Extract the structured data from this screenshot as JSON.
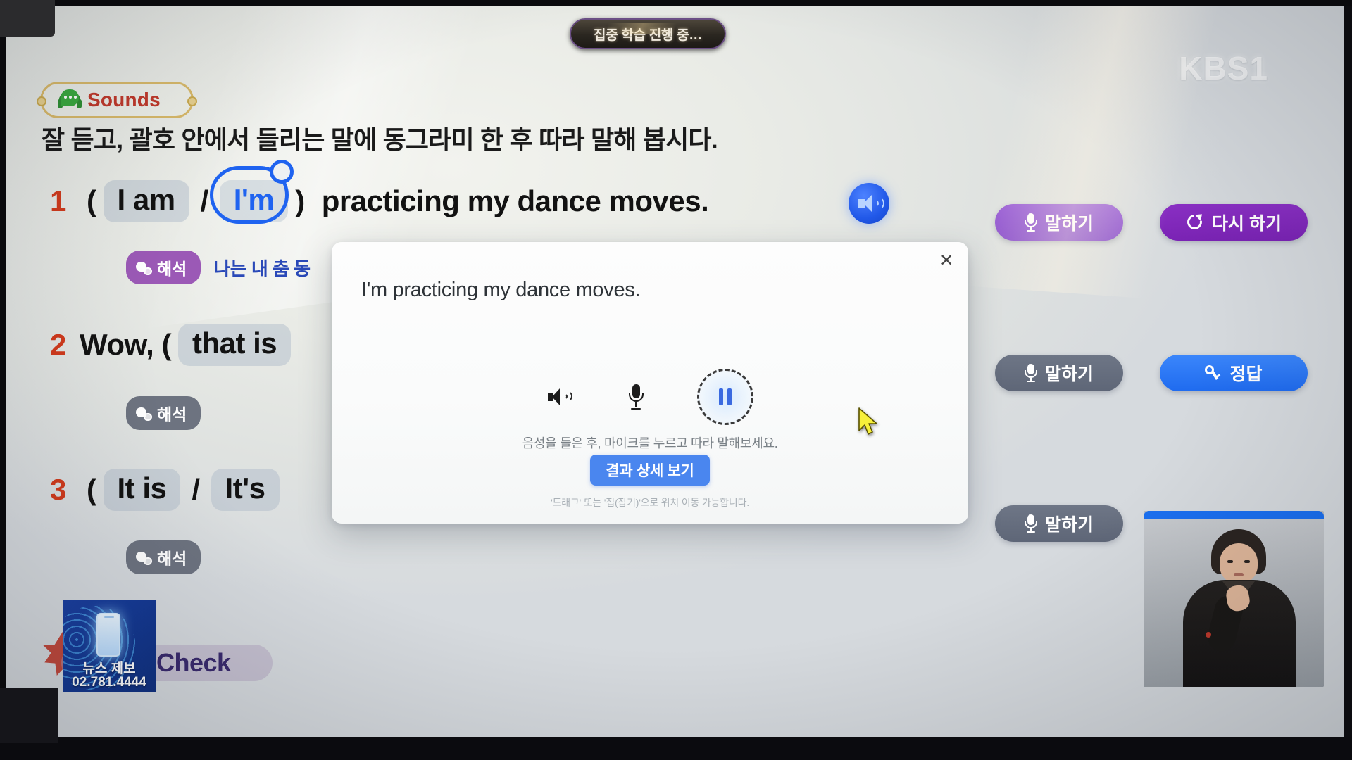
{
  "broadcast": {
    "status_pill": "집중 학습 진행 중…",
    "channel_logo": "KBS",
    "channel_number": "1",
    "news_tip": {
      "label": "뉴스 제보",
      "phone": "02.781.4444"
    }
  },
  "lesson": {
    "section_badge": "Sounds",
    "section_icon": "sounds-headphone-chat-icon",
    "instruction": "잘 듣고, 괄호 안에서 들리는 말에 동그라미 한 후 따라 말해 봅시다.",
    "self_check_label": "Self-Check",
    "items": [
      {
        "number": "1",
        "open_paren": "(",
        "choice_a": "I am",
        "slash": "/",
        "choice_b": "I'm",
        "close_paren": ")",
        "tail": "practicing my dance moves.",
        "circled": "choice_b",
        "hint_badge": "해석",
        "hint_badge_color": "#9b59b6",
        "hint_text": "나는 내 춤 동",
        "speaker_icon": "speaker-icon"
      },
      {
        "number": "2",
        "lead": "Wow, (",
        "choice_a": "that is",
        "hint_badge": "해석",
        "hint_badge_color": "#6d7380"
      },
      {
        "number": "3",
        "open_paren": "(",
        "choice_a": "It is",
        "slash": "/",
        "choice_b": "It's",
        "hint_badge": "해석",
        "hint_badge_color": "#6d7380"
      }
    ]
  },
  "actions": {
    "rows": [
      {
        "speak": "말하기",
        "secondary": "다시 하기",
        "secondary_icon": "refresh-icon",
        "speak_style": "purple",
        "secondary_style": "deep"
      },
      {
        "speak": "말하기",
        "secondary": "정답",
        "secondary_icon": "key-icon",
        "speak_style": "gray",
        "secondary_style": "blue"
      },
      {
        "speak": "말하기",
        "speak_style": "gray"
      }
    ],
    "mic_icon": "mic-icon"
  },
  "modal": {
    "close_icon": "close-icon",
    "sentence": "I'm practicing my dance moves.",
    "controls": {
      "speaker_icon": "speaker-icon",
      "mic_icon": "mic-icon",
      "pause_icon": "pause-icon"
    },
    "hint": "음성을 들은 후, 마이크를 누르고 따라 말해보세요.",
    "detail_button": "결과 상세 보기",
    "note": "'드래그' 또는 '집(잡기)'으로 위치 이동 가능합니다."
  },
  "colors": {
    "accent_blue": "#1f63f0",
    "accent_red": "#d03a1c",
    "purple": "#9b5fd6",
    "deep_purple": "#8a2fc4",
    "gray": "#6e7686",
    "blue": "#3b86fb",
    "gold": "#d8b96a",
    "sounds_red": "#c0392b"
  },
  "cursor": {
    "icon": "arrow-cursor",
    "color": "#f7f03a"
  }
}
